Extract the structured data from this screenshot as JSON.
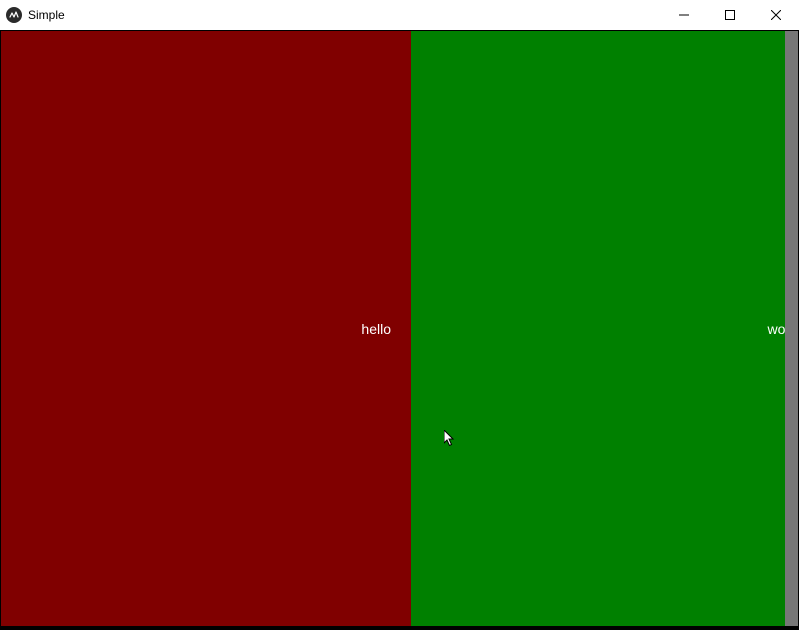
{
  "window": {
    "title": "Simple"
  },
  "panes": {
    "left": {
      "text": "hello",
      "bg": "#800000"
    },
    "right": {
      "text": "world",
      "bg": "#008000"
    }
  }
}
